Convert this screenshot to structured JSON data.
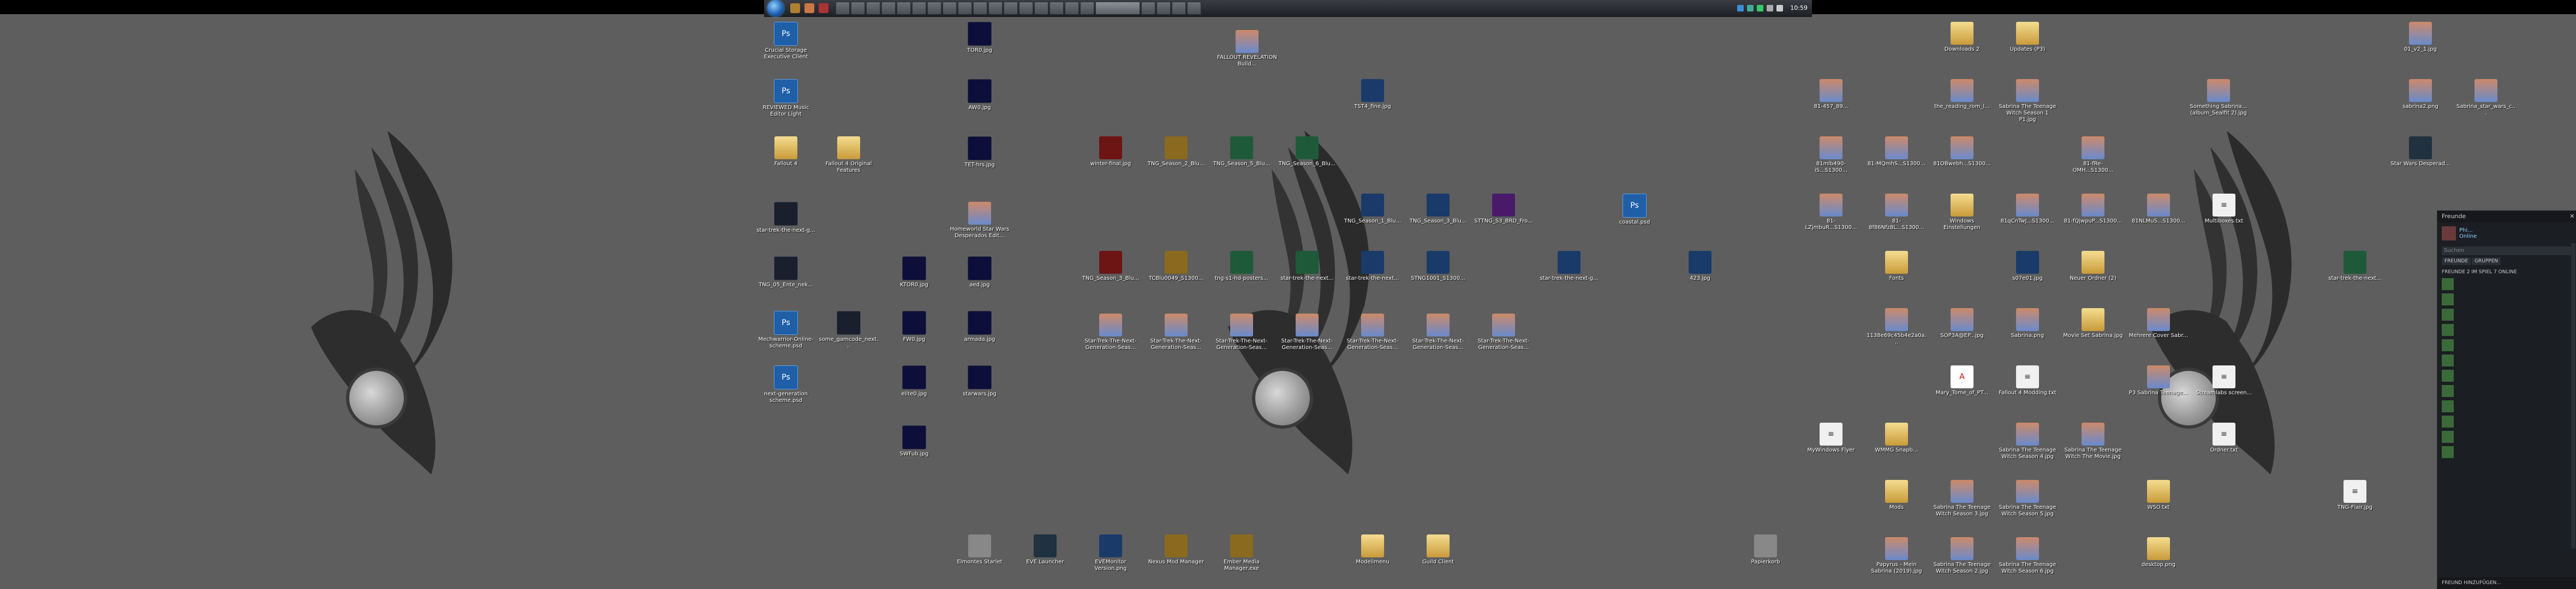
{
  "taskbar": {
    "clock": "10:59",
    "buttons": [
      "",
      "",
      "",
      "",
      "",
      "",
      "",
      "",
      "",
      "",
      "",
      "",
      "",
      "",
      "",
      "",
      "",
      "",
      "",
      "",
      "",
      ""
    ]
  },
  "desktop_icons": [
    {
      "label": "Crucial Storage Executive Client",
      "type": "ps"
    },
    {
      "label": "REVIEWED Music Editor Light",
      "type": "ps"
    },
    {
      "label": "Fallout 4",
      "type": "folder"
    },
    {
      "label": "Fallout 4 Original Features",
      "type": "folder"
    },
    {
      "label": "star-trek-the-next-g...",
      "type": "game"
    },
    {
      "label": "TNG_05_Ente_nek...",
      "type": "game"
    },
    {
      "label": "Mechwarrior-Online- scheme.psd",
      "type": "ps"
    },
    {
      "label": "some_gamcode_next...",
      "type": "game"
    },
    {
      "label": "next-generation scheme.psd",
      "type": "ps"
    },
    {
      "label": "TOR0.jpg",
      "type": "navy"
    },
    {
      "label": "AW0.jpg",
      "type": "navy"
    },
    {
      "label": "TET-hrs.jpg",
      "type": "navy"
    },
    {
      "label": "Homeworld Star Wars Desperados Edit...",
      "type": "img"
    },
    {
      "label": "KTOR0.jpg",
      "type": "navy"
    },
    {
      "label": "aed.jpg",
      "type": "navy"
    },
    {
      "label": "FW0.jpg",
      "type": "navy"
    },
    {
      "label": "armada.jpg",
      "type": "navy"
    },
    {
      "label": "elite0.jpg",
      "type": "navy"
    },
    {
      "label": "starwars.jpg",
      "type": "navy"
    },
    {
      "label": "SWFub.jpg",
      "type": "navy"
    },
    {
      "label": "FALLOUT REVELATION Build...",
      "type": "img"
    },
    {
      "label": "TST4_fine.jpg",
      "type": "blue"
    },
    {
      "label": "winter-final.jpg",
      "type": "red"
    },
    {
      "label": "TNG_Season_2_Blu...",
      "type": "gold"
    },
    {
      "label": "TNG_Season_5_Blu...",
      "type": "green"
    },
    {
      "label": "TNG_Season_6_Blu...",
      "type": "green"
    },
    {
      "label": "TNG_Season_1_Blu...",
      "type": "blue"
    },
    {
      "label": "TNG_Season_3_Blu...",
      "type": "blue"
    },
    {
      "label": "STTNG_S3_BRD_Fro...",
      "type": "purple"
    },
    {
      "label": "coastal.psd",
      "type": "ps"
    },
    {
      "label": "TNG_Season_3_Blu...",
      "type": "red"
    },
    {
      "label": "TCBlu0049_S1300...",
      "type": "gold"
    },
    {
      "label": "tng-s1-hd-posters...",
      "type": "green"
    },
    {
      "label": "star-trek-the-next...",
      "type": "green"
    },
    {
      "label": "star-trek-the-next...",
      "type": "blue"
    },
    {
      "label": "STNG1001_S1300...",
      "type": "blue"
    },
    {
      "label": "star-trek-the-next-g...",
      "type": "blue"
    },
    {
      "label": "423.jpg",
      "type": "blue"
    },
    {
      "label": "Star-Trek-The-Next-Generation-Seas...",
      "type": "img"
    },
    {
      "label": "Star-Trek-The-Next-Generation-Seas...",
      "type": "img"
    },
    {
      "label": "Star-Trek-The-Next-Generation-Seas...",
      "type": "img"
    },
    {
      "label": "Star-Trek-The-Next-Generation-Seas...",
      "type": "img"
    },
    {
      "label": "Star-Trek-The-Next-Generation-Seas...",
      "type": "img"
    },
    {
      "label": "Star-Trek-The-Next-Generation-Seas...",
      "type": "img"
    },
    {
      "label": "Star-Trek-The-Next-Generation-Seas...",
      "type": "img"
    },
    {
      "label": "Elmontes Starlet",
      "type": "grey"
    },
    {
      "label": "EVE Launcher",
      "type": "steam"
    },
    {
      "label": "EVEMonitor Version.png",
      "type": "blue"
    },
    {
      "label": "Nexus Mod Manager",
      "type": "gold"
    },
    {
      "label": "Ember Media Manager.exe",
      "type": "gold"
    },
    {
      "label": "Modelimenu",
      "type": "folder"
    },
    {
      "label": "Guild Client",
      "type": "folder"
    },
    {
      "label": "Papierkorb",
      "type": "grey"
    },
    {
      "label": "Downloads 2",
      "type": "folder"
    },
    {
      "label": "Updates (P3)",
      "type": "folder"
    },
    {
      "label": "81-457_89...",
      "type": "img"
    },
    {
      "label": "the_reading_rom_l...",
      "type": "img"
    },
    {
      "label": "Sabrina The Teenage Witch Season 1 P1.jpg",
      "type": "img"
    },
    {
      "label": "Something Sabrina... (album_Sealfit 2).jpg",
      "type": "img"
    },
    {
      "label": "81mlb490-iS...S1300...",
      "type": "img"
    },
    {
      "label": "81-MQmhS...S1300...",
      "type": "img"
    },
    {
      "label": "81OBwebh...S1300...",
      "type": "img"
    },
    {
      "label": "81-fRe-OMH...S1300...",
      "type": "img"
    },
    {
      "label": "81-LZjmbuR...S1300...",
      "type": "img"
    },
    {
      "label": "81-8f86Nfz8L...S1300...",
      "type": "img"
    },
    {
      "label": "Windows Einstellungen",
      "type": "folder"
    },
    {
      "label": "81qCnTwJ...S1300...",
      "type": "img"
    },
    {
      "label": "81-fQjwpuP...S1300...",
      "type": "img"
    },
    {
      "label": "81NLMuS...S1300...",
      "type": "img"
    },
    {
      "label": "Multiboxes.txt",
      "type": "doc"
    },
    {
      "label": "Fonts",
      "type": "folder"
    },
    {
      "label": "s07e01.jpg",
      "type": "blue"
    },
    {
      "label": "Neuer Ordner (2)",
      "type": "folder"
    },
    {
      "label": "1138e69c45b4e2a0a...",
      "type": "img"
    },
    {
      "label": "SOP3A@EP...jpg",
      "type": "img"
    },
    {
      "label": "Sabrina.png",
      "type": "img"
    },
    {
      "label": "Movie Set Sabrina.jpg",
      "type": "folder"
    },
    {
      "label": "Mehrere Cover Sabr...",
      "type": "img"
    },
    {
      "label": "Mary_Tome_of_PT...",
      "type": "pdf"
    },
    {
      "label": "Fallout 4 Modding.txt",
      "type": "doc"
    },
    {
      "label": "P3 Sabrina Teenage...",
      "type": "img"
    },
    {
      "label": "Streamlabs screen...",
      "type": "doc"
    },
    {
      "label": "MyWindows Flyer",
      "type": "doc"
    },
    {
      "label": "WMMG Snapb...",
      "type": "folder"
    },
    {
      "label": "Sabrina The Teenage Witch Season 4.jpg",
      "type": "img"
    },
    {
      "label": "Sabrina The Teenage Witch The Movie.jpg",
      "type": "img"
    },
    {
      "label": "Ordner.txt",
      "type": "doc"
    },
    {
      "label": "Mods",
      "type": "folder"
    },
    {
      "label": "Sabrina The Teenage Witch Season 3.jpg",
      "type": "img"
    },
    {
      "label": "Sabrina The Teenage Witch Season 5.jpg",
      "type": "img"
    },
    {
      "label": "WSO.txt",
      "type": "folder"
    },
    {
      "label": "Papyrus - Mein Sabrina (2019).jpg",
      "type": "img"
    },
    {
      "label": "Sabrina The Teenage Witch Season 2.jpg",
      "type": "img"
    },
    {
      "label": "Sabrina The Teenage Witch Season 6.jpg",
      "type": "img"
    },
    {
      "label": "desktop.png",
      "type": "folder"
    },
    {
      "label": "01_v2_1.jpg",
      "type": "img"
    },
    {
      "label": "sabrina2.png",
      "type": "img"
    },
    {
      "label": "Sabrina_star_wars_c...",
      "type": "img"
    },
    {
      "label": "Star Wars Desperad...",
      "type": "steam"
    },
    {
      "label": "star-trek-the-next...",
      "type": "green"
    },
    {
      "label": "TNG-Flair.jpg",
      "type": "doc"
    }
  ],
  "steam": {
    "title": "Freunde",
    "user_name": "Phi...",
    "user_status": "Online",
    "search_placeholder": "Suchen",
    "tab_friends": "FREUNDE",
    "tab_groups": "GRUPPEN",
    "section": "FREUNDE 2 IM SPIEL 7 ONLINE",
    "friends": [
      "",
      "",
      "",
      "",
      "",
      "",
      "",
      "",
      "",
      "",
      "",
      ""
    ],
    "add_friend": "FREUND HINZUFÜGEN..."
  }
}
